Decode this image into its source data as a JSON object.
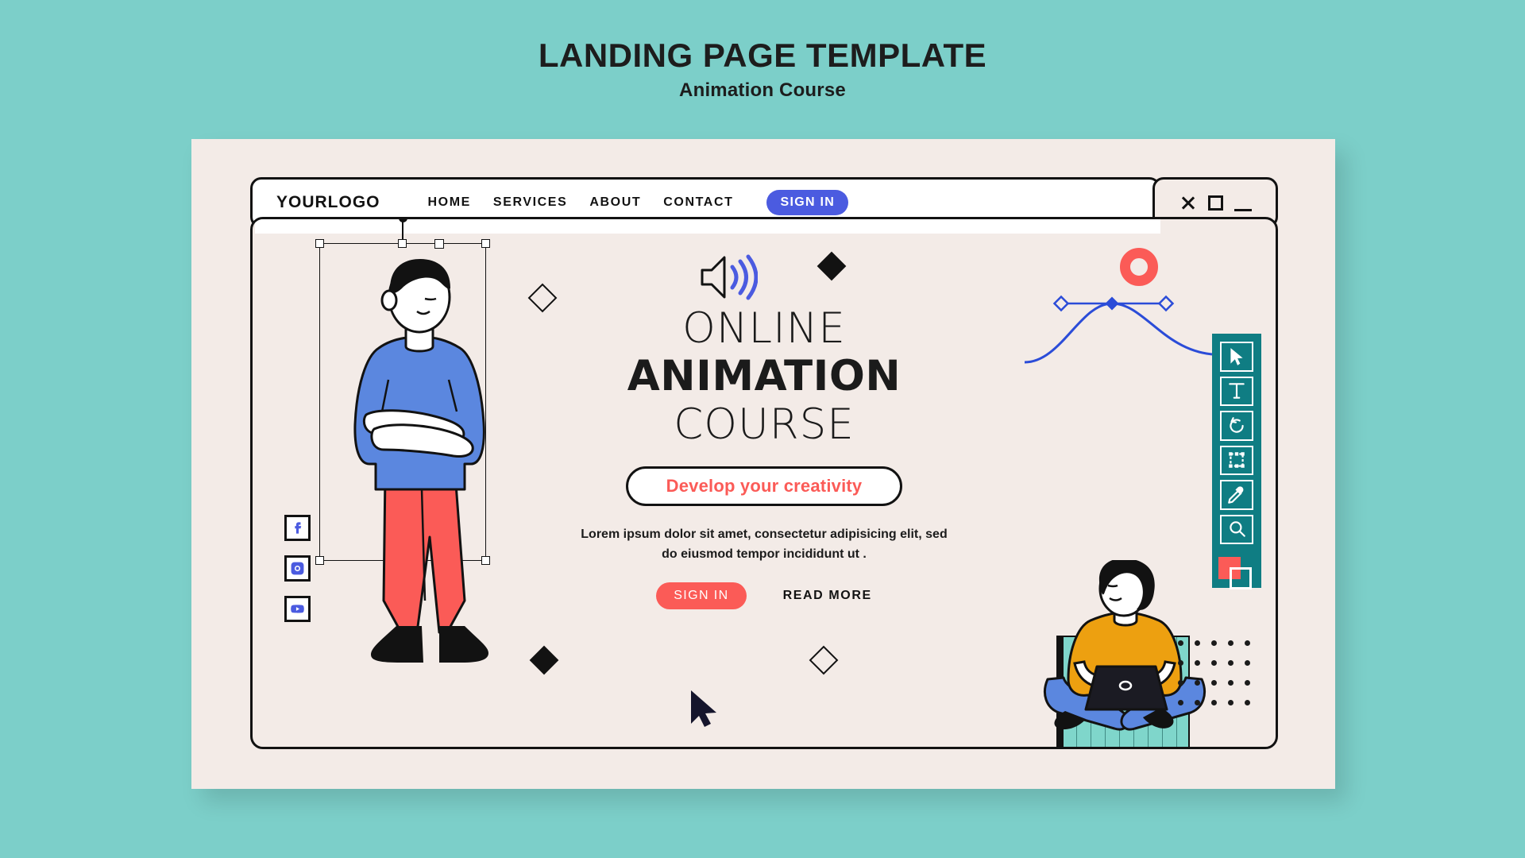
{
  "poster": {
    "title": "LANDING PAGE TEMPLATE",
    "subtitle": "Animation Course"
  },
  "colors": {
    "page_background": "#7ccfc9",
    "card_background": "#f3ebe7",
    "accent_blue": "#4b5be0",
    "accent_coral": "#fb5b57",
    "palette_teal": "#0f7d83",
    "pedestal_teal": "#7fd6cb",
    "ink": "#121212"
  },
  "browser": {
    "nav": {
      "logo": "YOURLOGO",
      "links": [
        {
          "label": "HOME"
        },
        {
          "label": "SERVICES"
        },
        {
          "label": "ABOUT"
        },
        {
          "label": "CONTACT"
        }
      ],
      "signin_label": "SIGN IN"
    },
    "window_controls": [
      {
        "name": "close-icon",
        "glyph": "×"
      },
      {
        "name": "maximize-icon",
        "glyph": "□"
      },
      {
        "name": "minimize-icon",
        "glyph": "_"
      }
    ]
  },
  "hero": {
    "line1": "ONLINE",
    "line2": "ANIMATION",
    "line3": "COURSE",
    "cta_label": "Develop your creativity",
    "paragraph": "Lorem ipsum dolor sit amet, consectetur adipisicing elit, sed do eiusmod tempor incididunt ut .",
    "primary_button": "SIGN IN",
    "secondary_button": "READ MORE"
  },
  "social": [
    {
      "name": "facebook-icon",
      "label": "Facebook"
    },
    {
      "name": "instagram-icon",
      "label": "Instagram"
    },
    {
      "name": "youtube-icon",
      "label": "YouTube"
    }
  ],
  "toolbar": {
    "tools": [
      {
        "name": "cursor-tool",
        "label": "Selection"
      },
      {
        "name": "text-tool",
        "label": "Text"
      },
      {
        "name": "rotate-tool",
        "label": "Rotate"
      },
      {
        "name": "transform-tool",
        "label": "Transform"
      },
      {
        "name": "eyedropper-tool",
        "label": "Eyedropper"
      },
      {
        "name": "zoom-tool",
        "label": "Zoom"
      }
    ],
    "swatch": {
      "name": "color-swatch",
      "foreground": "#fb5b57",
      "background": "#ffffff"
    }
  },
  "canvas": {
    "selection_label": "Selection bounding box",
    "speaker_icon": "speaker-icon",
    "bezier_label": "bezier-curve",
    "cursor_label": "mouse-cursor"
  }
}
